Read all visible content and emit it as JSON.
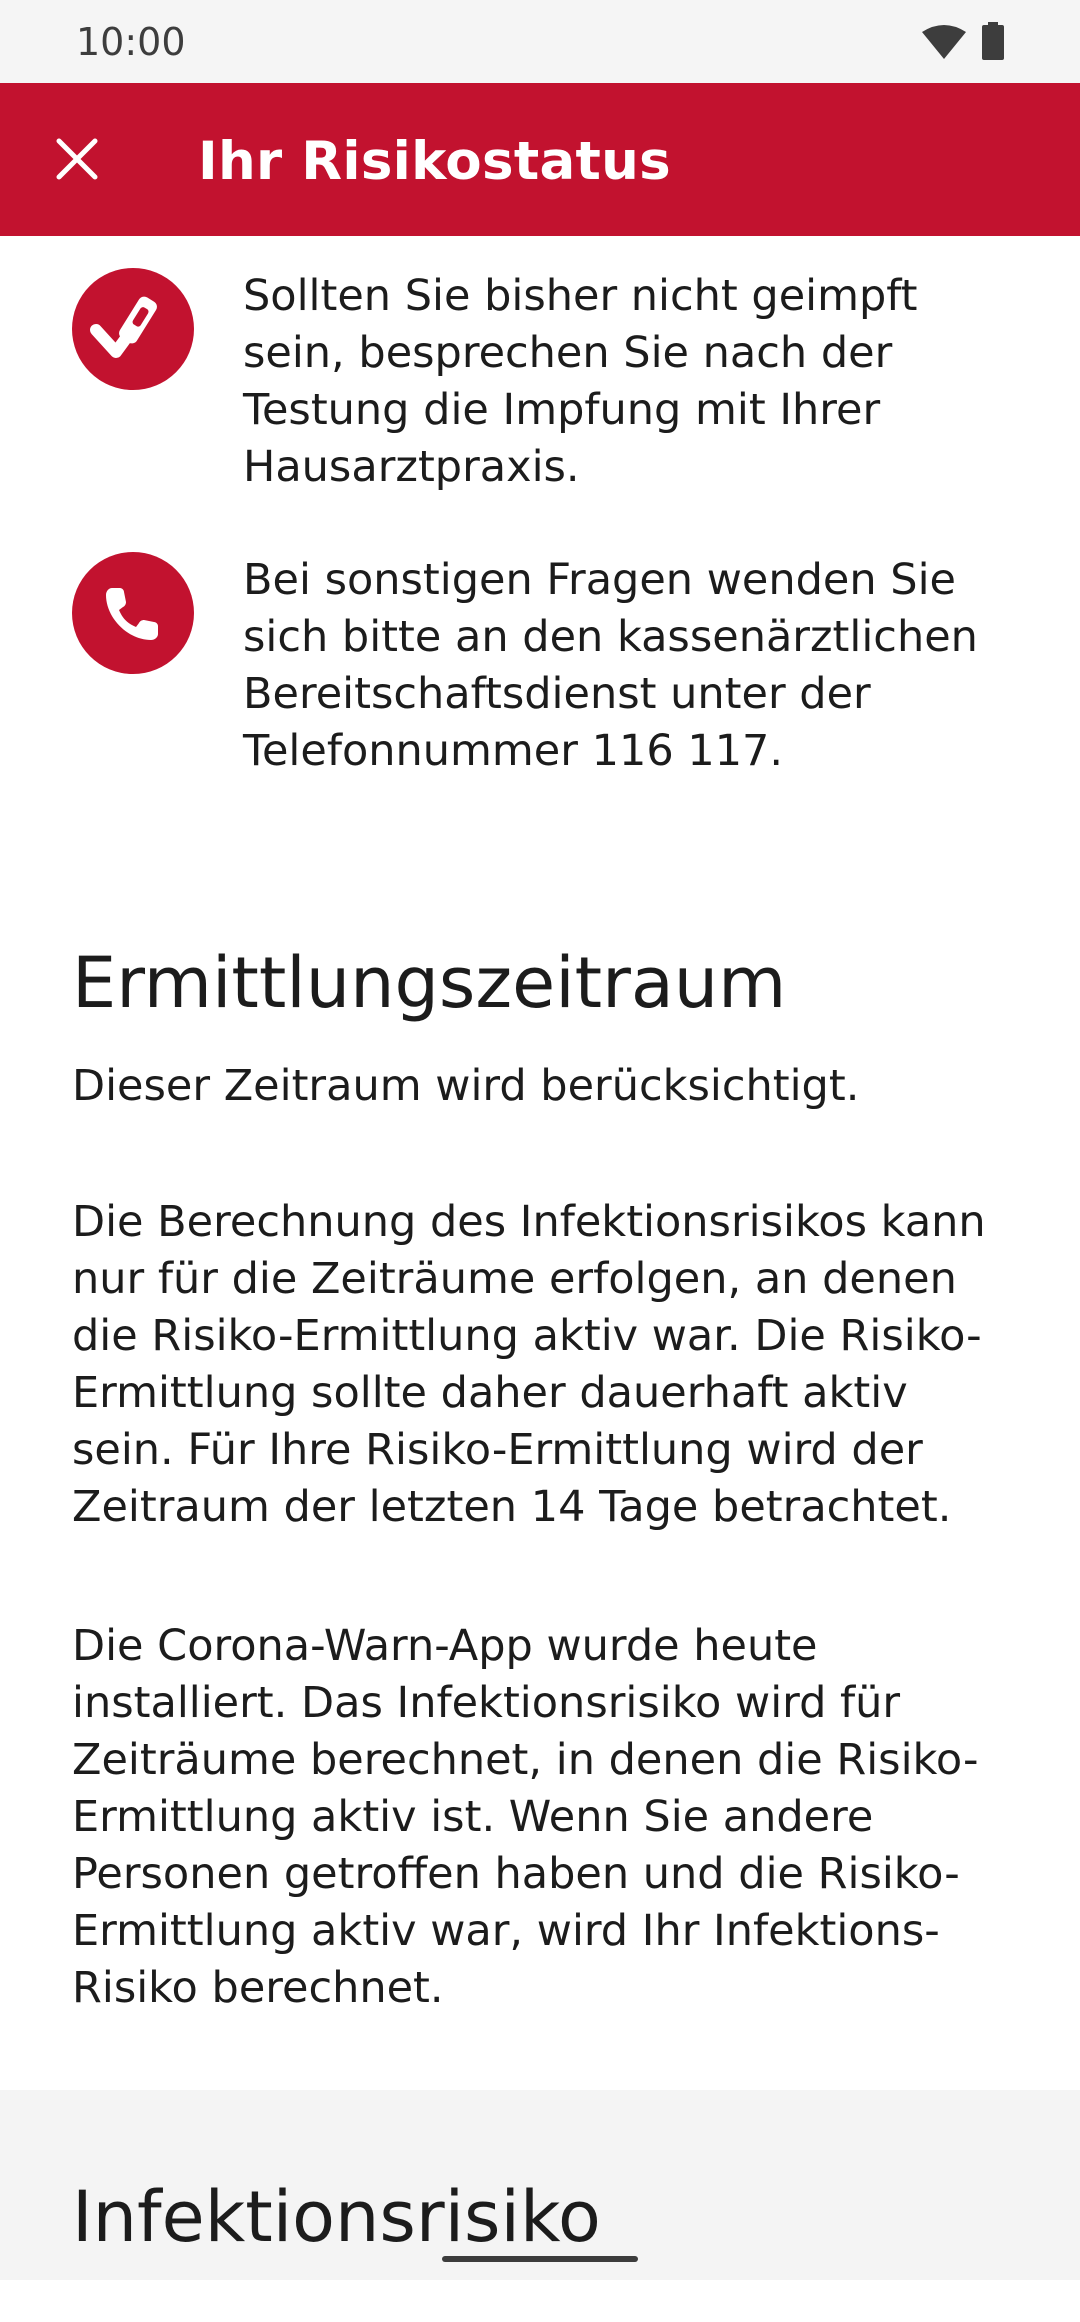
{
  "status_bar": {
    "time": "10:00",
    "wifi_icon": "wifi-icon",
    "battery_icon": "battery-icon"
  },
  "app_bar": {
    "title": "Ihr Risikostatus",
    "close_icon": "close-icon",
    "background": "#c2122f"
  },
  "info_items": [
    {
      "icon": "vaccine-icon",
      "text": "Sollten Sie bisher nicht geimpft sein, besprechen Sie nach der Testung die Impfung mit Ihrer Hausarztpraxis."
    },
    {
      "icon": "phone-icon",
      "text": "Bei sonstigen Fragen wenden Sie sich bitte an den kassenärztlichen Bereitschaftsdienst unter der Telefonnummer 116 117."
    }
  ],
  "period_section": {
    "heading": "Ermittlungszeitraum",
    "subtitle": "Dieser Zeitraum wird berücksichtigt.",
    "paragraph1": "Die Berechnung des Infektionsrisikos kann nur für die Zeiträume erfolgen, an denen die Risiko-Ermittlung aktiv war. Die Risiko-Ermittlung sollte daher dauerhaft aktiv sein. Für Ihre Risiko-Ermittlung wird der Zeitraum der letzten 14 Tage betrachtet.",
    "paragraph2": "Die Corona-Warn-App wurde heute installiert. Das Infektionsrisiko wird für Zeiträume berechnet, in denen die Risiko-Ermittlung aktiv ist. Wenn Sie andere Personen getroffen haben und die Risiko-Ermittlung aktiv war, wird Ihr Infektions-Risiko berechnet."
  },
  "infection_section": {
    "heading": "Infektionsrisiko"
  }
}
